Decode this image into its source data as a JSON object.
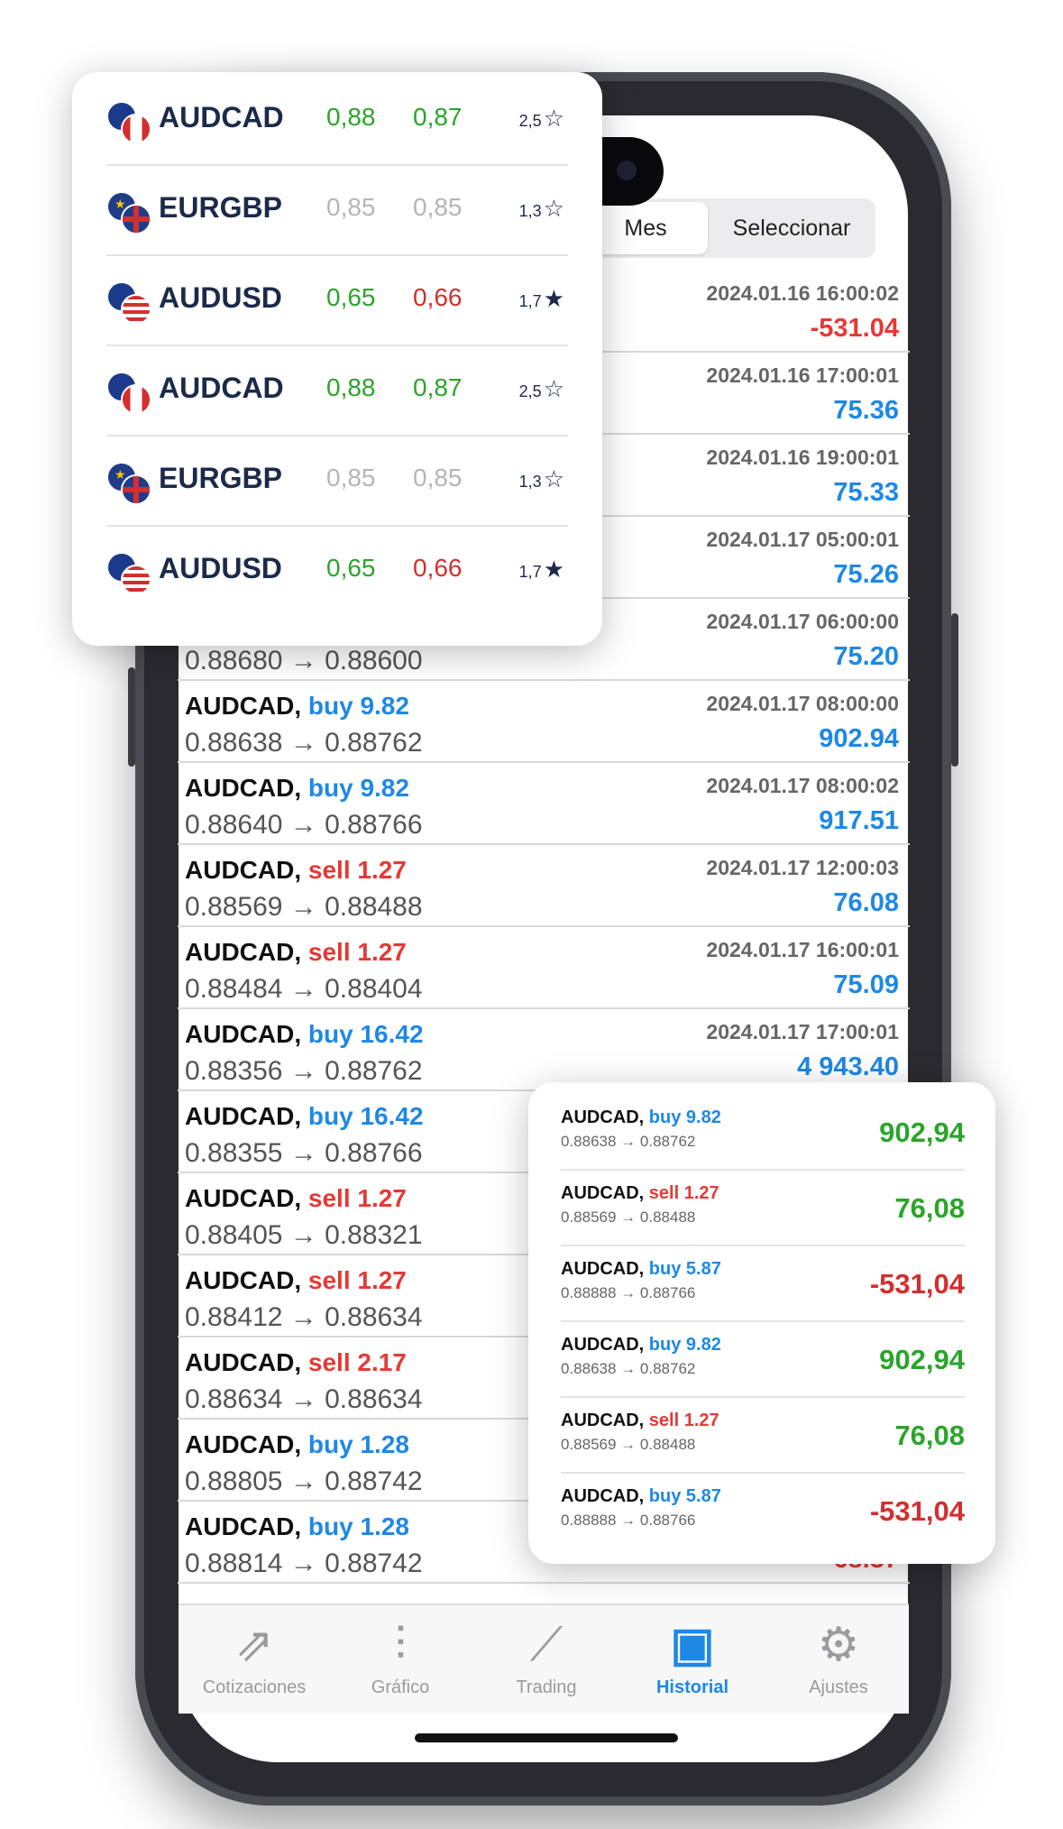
{
  "segment": {
    "month": "Mes",
    "select": "Seleccionar"
  },
  "history": [
    {
      "symbol": "",
      "side": "",
      "side_type": "",
      "prices": "",
      "time": "2024.01.16 16:00:02",
      "profit": "-531.04",
      "profit_type": "neg"
    },
    {
      "symbol": "",
      "side": "",
      "side_type": "",
      "prices": "",
      "time": "2024.01.16 17:00:01",
      "profit": "75.36",
      "profit_type": "pos"
    },
    {
      "symbol": "",
      "side": "",
      "side_type": "",
      "prices": "",
      "time": "2024.01.16 19:00:01",
      "profit": "75.33",
      "profit_type": "pos"
    },
    {
      "symbol": "",
      "side": "",
      "side_type": "",
      "prices": "",
      "time": "2024.01.17 05:00:01",
      "profit": "75.26",
      "profit_type": "pos"
    },
    {
      "symbol": "",
      "side": "",
      "side_type": "",
      "prices": "0.88680 → 0.88600",
      "time": "2024.01.17 06:00:00",
      "profit": "75.20",
      "profit_type": "pos"
    },
    {
      "symbol": "AUDCAD,",
      "side": "buy 9.82",
      "side_type": "buy",
      "prices": "0.88638 → 0.88762",
      "time": "2024.01.17 08:00:00",
      "profit": "902.94",
      "profit_type": "pos"
    },
    {
      "symbol": "AUDCAD,",
      "side": "buy 9.82",
      "side_type": "buy",
      "prices": "0.88640 → 0.88766",
      "time": "2024.01.17 08:00:02",
      "profit": "917.51",
      "profit_type": "pos"
    },
    {
      "symbol": "AUDCAD,",
      "side": "sell 1.27",
      "side_type": "sell",
      "prices": "0.88569 → 0.88488",
      "time": "2024.01.17 12:00:03",
      "profit": "76.08",
      "profit_type": "pos"
    },
    {
      "symbol": "AUDCAD,",
      "side": "sell 1.27",
      "side_type": "sell",
      "prices": "0.88484 → 0.88404",
      "time": "2024.01.17 16:00:01",
      "profit": "75.09",
      "profit_type": "pos"
    },
    {
      "symbol": "AUDCAD,",
      "side": "buy 16.42",
      "side_type": "buy",
      "prices": "0.88356 → 0.88762",
      "time": "2024.01.17 17:00:01",
      "profit": "4 943.40",
      "profit_type": "pos"
    },
    {
      "symbol": "AUDCAD,",
      "side": "buy 16.42",
      "side_type": "buy",
      "prices": "0.88355 → 0.88766",
      "time": "",
      "profit": "",
      "profit_type": "pos"
    },
    {
      "symbol": "AUDCAD,",
      "side": "sell 1.27",
      "side_type": "sell",
      "prices": "0.88405 → 0.88321",
      "time": "",
      "profit": "",
      "profit_type": "pos"
    },
    {
      "symbol": "AUDCAD,",
      "side": "sell 1.27",
      "side_type": "sell",
      "prices": "0.88412 → 0.88634",
      "time": "",
      "profit": "",
      "profit_type": "pos"
    },
    {
      "symbol": "AUDCAD,",
      "side": "sell 2.17",
      "side_type": "sell",
      "prices": "0.88634 → 0.88634",
      "time": "",
      "profit": "",
      "profit_type": "pos"
    },
    {
      "symbol": "AUDCAD,",
      "side": "buy 1.28",
      "side_type": "buy",
      "prices": "0.88805 → 0.88742",
      "time": "",
      "profit": "",
      "profit_type": "pos"
    },
    {
      "symbol": "AUDCAD,",
      "side": "buy 1.28",
      "side_type": "buy",
      "prices": "0.88814 → 0.88742",
      "time": "",
      "profit": "-68.37",
      "profit_type": "neg"
    }
  ],
  "tabs": [
    {
      "label": "Cotizaciones",
      "icon": "quotes-icon",
      "glyph": "⇗",
      "active": false
    },
    {
      "label": "Gráfico",
      "icon": "chart-icon",
      "glyph": "⫶",
      "active": false
    },
    {
      "label": "Trading",
      "icon": "trading-icon",
      "glyph": "⟋",
      "active": false
    },
    {
      "label": "Historial",
      "icon": "inbox-icon",
      "glyph": "▣",
      "active": true
    },
    {
      "label": "Ajustes",
      "icon": "gear-icon",
      "glyph": "⚙",
      "active": false
    }
  ],
  "quotes": [
    {
      "symbol": "AUDCAD",
      "flags": [
        "au",
        "ca"
      ],
      "bid": "0,88",
      "ask": "0,87",
      "bid_color": "green",
      "ask_color": "green",
      "spread": "2,5",
      "starred": false
    },
    {
      "symbol": "EURGBP",
      "flags": [
        "eu",
        "gb"
      ],
      "bid": "0,85",
      "ask": "0,85",
      "bid_color": "grey",
      "ask_color": "grey",
      "spread": "1,3",
      "starred": false
    },
    {
      "symbol": "AUDUSD",
      "flags": [
        "au",
        "us"
      ],
      "bid": "0,65",
      "ask": "0,66",
      "bid_color": "green",
      "ask_color": "red",
      "spread": "1,7",
      "starred": true
    },
    {
      "symbol": "AUDCAD",
      "flags": [
        "au",
        "ca"
      ],
      "bid": "0,88",
      "ask": "0,87",
      "bid_color": "green",
      "ask_color": "green",
      "spread": "2,5",
      "starred": false
    },
    {
      "symbol": "EURGBP",
      "flags": [
        "eu",
        "gb"
      ],
      "bid": "0,85",
      "ask": "0,85",
      "bid_color": "grey",
      "ask_color": "grey",
      "spread": "1,3",
      "starred": false
    },
    {
      "symbol": "AUDUSD",
      "flags": [
        "au",
        "us"
      ],
      "bid": "0,65",
      "ask": "0,66",
      "bid_color": "green",
      "ask_color": "red",
      "spread": "1,7",
      "starred": true
    }
  ],
  "trades": [
    {
      "symbol": "AUDCAD,",
      "side": "buy 9.82",
      "side_type": "buy",
      "prices": "0.88638 → 0.88762",
      "profit": "902,94",
      "profit_type": "pos"
    },
    {
      "symbol": "AUDCAD,",
      "side": "sell 1.27",
      "side_type": "sell",
      "prices": "0.88569 → 0.88488",
      "profit": "76,08",
      "profit_type": "pos"
    },
    {
      "symbol": "AUDCAD,",
      "side": "buy 5.87",
      "side_type": "buy",
      "prices": "0.88888 → 0.88766",
      "profit": "-531,04",
      "profit_type": "neg"
    },
    {
      "symbol": "AUDCAD,",
      "side": "buy 9.82",
      "side_type": "buy",
      "prices": "0.88638 → 0.88762",
      "profit": "902,94",
      "profit_type": "pos"
    },
    {
      "symbol": "AUDCAD,",
      "side": "sell 1.27",
      "side_type": "sell",
      "prices": "0.88569 → 0.88488",
      "profit": "76,08",
      "profit_type": "pos"
    },
    {
      "symbol": "AUDCAD,",
      "side": "buy 5.87",
      "side_type": "buy",
      "prices": "0.88888 → 0.88766",
      "profit": "-531,04",
      "profit_type": "neg"
    }
  ],
  "colors": {
    "buy": "#1e88e5",
    "sell": "#e53935",
    "positive": "#2aa52a",
    "negative": "#d32f2f",
    "accent": "#1e88e5"
  }
}
